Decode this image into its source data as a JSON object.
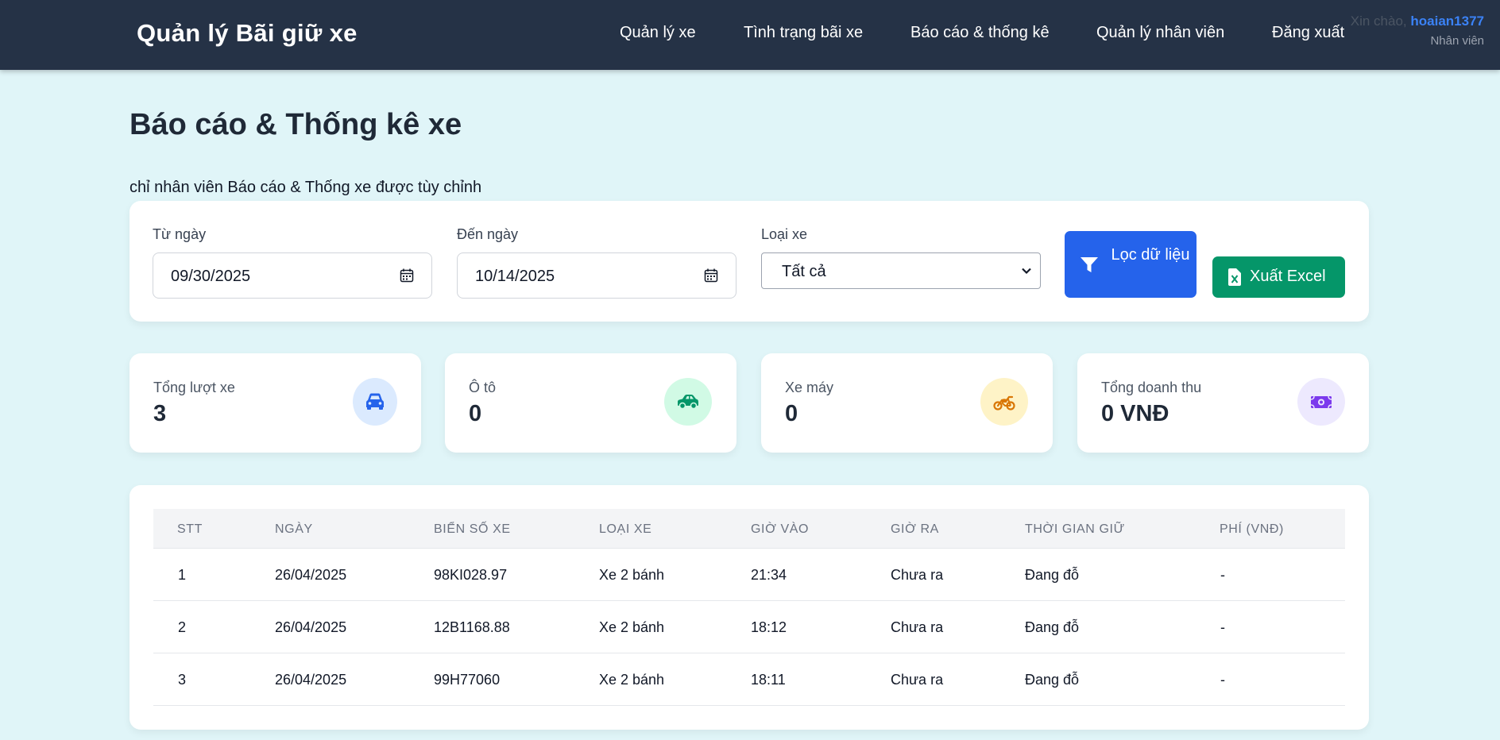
{
  "app": {
    "brand": "Quản lý Bãi giữ xe"
  },
  "nav": {
    "items": [
      {
        "label": "Quản lý xe"
      },
      {
        "label": "Tình trạng bãi xe"
      },
      {
        "label": "Báo cáo & thống kê"
      },
      {
        "label": "Quản lý nhân viên"
      },
      {
        "label": "Đăng xuất"
      }
    ]
  },
  "user": {
    "greeting": "Xin chào,",
    "username": "hoaian1377",
    "role": "Nhân viên"
  },
  "page": {
    "title": "Báo cáo & Thống kê xe",
    "subtitle": "chỉ nhân viên Báo cáo & Thống xe được tùy chỉnh"
  },
  "filter": {
    "from_label": "Từ ngày",
    "from_value": "09/30/2025",
    "to_label": "Đến ngày",
    "to_value": "10/14/2025",
    "type_label": "Loại xe",
    "type_selected": "Tất cả",
    "filter_button": "Lọc dữ liệu",
    "export_button": "Xuất Excel"
  },
  "stats": [
    {
      "label": "Tổng lượt xe",
      "value": "3",
      "icon": "car-front-icon",
      "icon_color": "#2563eb",
      "icon_bg": "#dbeafe"
    },
    {
      "label": "Ô tô",
      "value": "0",
      "icon": "car-side-icon",
      "icon_color": "#059669",
      "icon_bg": "#d1fae5"
    },
    {
      "label": "Xe máy",
      "value": "0",
      "icon": "motorcycle-icon",
      "icon_color": "#d97706",
      "icon_bg": "#fef3c7"
    },
    {
      "label": "Tổng doanh thu",
      "value": "0 VNĐ",
      "icon": "money-icon",
      "icon_color": "#7c3aed",
      "icon_bg": "#ede9fe"
    }
  ],
  "table": {
    "headers": [
      "STT",
      "NGÀY",
      "BIỂN SỐ XE",
      "LOẠI XE",
      "GIỜ VÀO",
      "GIỜ RA",
      "THỜI GIAN GIỮ",
      "PHÍ (VNĐ)"
    ],
    "rows": [
      [
        "1",
        "26/04/2025",
        "98KI028.97",
        "Xe 2 bánh",
        "21:34",
        "Chưa ra",
        "Đang đỗ",
        "-"
      ],
      [
        "2",
        "26/04/2025",
        "12B1168.88",
        "Xe 2 bánh",
        "18:12",
        "Chưa ra",
        "Đang đỗ",
        "-"
      ],
      [
        "3",
        "26/04/2025",
        "99H77060",
        "Xe 2 bánh",
        "18:11",
        "Chưa ra",
        "Đang đỗ",
        "-"
      ]
    ]
  },
  "colors": {
    "topbar": "#253246",
    "background": "#e0f5f8",
    "primary": "#2563eb",
    "success": "#059669"
  }
}
